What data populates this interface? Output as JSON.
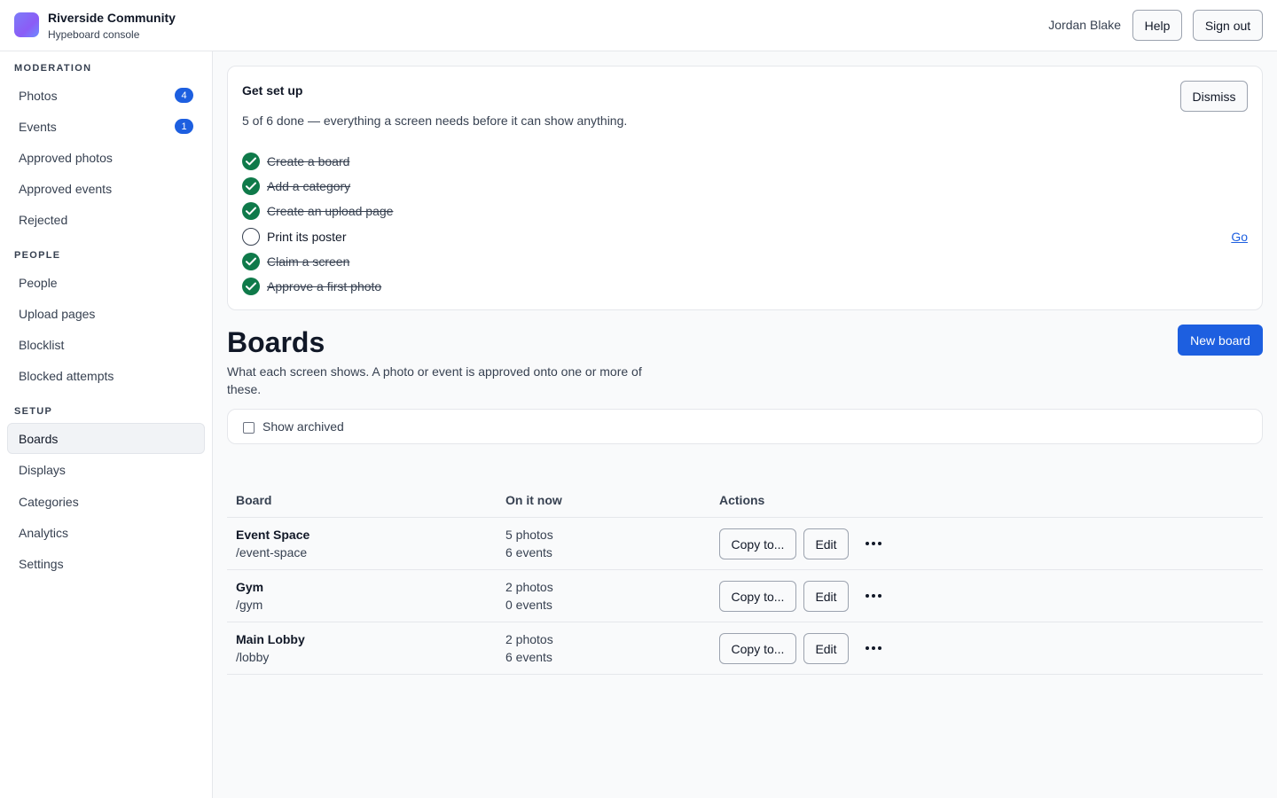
{
  "header": {
    "org_name": "Riverside Community",
    "org_sub": "Hypeboard console",
    "user_name": "Jordan Blake",
    "help_label": "Help",
    "signout_label": "Sign out"
  },
  "sidebar": {
    "sections": [
      {
        "label": "MODERATION",
        "items": [
          {
            "label": "Photos",
            "badge": "4"
          },
          {
            "label": "Events",
            "badge": "1"
          },
          {
            "label": "Approved photos"
          },
          {
            "label": "Approved events"
          },
          {
            "label": "Rejected"
          }
        ]
      },
      {
        "label": "PEOPLE",
        "items": [
          {
            "label": "People"
          },
          {
            "label": "Upload pages"
          },
          {
            "label": "Blocklist"
          },
          {
            "label": "Blocked attempts"
          }
        ]
      },
      {
        "label": "SETUP",
        "items": [
          {
            "label": "Boards",
            "active": true
          },
          {
            "label": "Displays"
          },
          {
            "label": "Categories"
          },
          {
            "label": "Analytics"
          },
          {
            "label": "Settings"
          }
        ]
      }
    ]
  },
  "setup": {
    "title": "Get set up",
    "description": "5 of 6 done — everything a screen needs before it can show anything.",
    "dismiss_label": "Dismiss",
    "go_label": "Go",
    "steps": [
      {
        "label": "Create a board",
        "done": true
      },
      {
        "label": "Add a category",
        "done": true
      },
      {
        "label": "Create an upload page",
        "done": true
      },
      {
        "label": "Print its poster",
        "done": false
      },
      {
        "label": "Claim a screen",
        "done": true
      },
      {
        "label": "Approve a first photo",
        "done": true
      }
    ]
  },
  "main": {
    "title": "Boards",
    "description": "What each screen shows. A photo or event is approved onto one or more of these.",
    "new_board_label": "New board",
    "show_archived_label": "Show archived"
  },
  "table": {
    "headers": {
      "board": "Board",
      "on_it_now": "On it now",
      "actions": "Actions"
    },
    "copy_label": "Copy to...",
    "edit_label": "Edit",
    "rows": [
      {
        "name": "Event Space",
        "path": "/event-space",
        "photos": "5 photos",
        "events": "6 events"
      },
      {
        "name": "Gym",
        "path": "/gym",
        "photos": "2 photos",
        "events": "0 events"
      },
      {
        "name": "Main Lobby",
        "path": "/lobby",
        "photos": "2 photos",
        "events": "6 events"
      }
    ]
  },
  "colors": {
    "accent": "#1d5fe0",
    "success": "#0f7a4a"
  }
}
